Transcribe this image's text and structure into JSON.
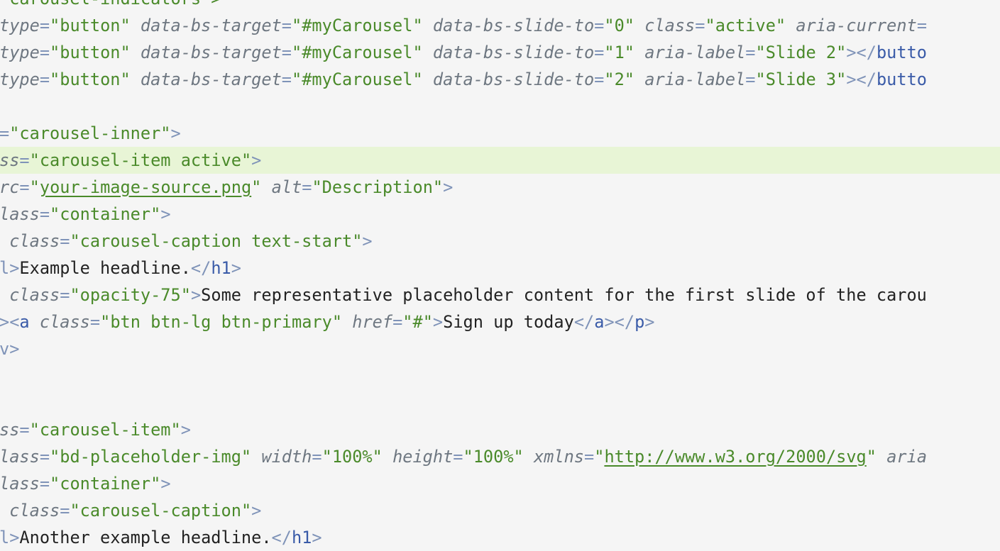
{
  "editor": {
    "current_line_index": 6,
    "colors": {
      "background": "#f5f5f5",
      "current_line": "#e8f5d6",
      "attribute": "#6e7781",
      "punctuation": "#7f93b8",
      "string": "#4a8a2a",
      "tag": "#3a5ba8",
      "text": "#222222"
    },
    "lines": [
      [
        {
          "t": "\"carousel-indicators\">",
          "k": "str"
        }
      ],
      [
        {
          "t": "type",
          "k": "attr"
        },
        {
          "t": "=",
          "k": "punct"
        },
        {
          "t": "\"button\"",
          "k": "str"
        },
        {
          "t": " ",
          "k": "text"
        },
        {
          "t": "data-bs-target",
          "k": "attr"
        },
        {
          "t": "=",
          "k": "punct"
        },
        {
          "t": "\"#myCarousel\"",
          "k": "str"
        },
        {
          "t": " ",
          "k": "text"
        },
        {
          "t": "data-bs-slide-to",
          "k": "attr"
        },
        {
          "t": "=",
          "k": "punct"
        },
        {
          "t": "\"0\"",
          "k": "str"
        },
        {
          "t": " ",
          "k": "text"
        },
        {
          "t": "class",
          "k": "attr"
        },
        {
          "t": "=",
          "k": "punct"
        },
        {
          "t": "\"active\"",
          "k": "str"
        },
        {
          "t": " ",
          "k": "text"
        },
        {
          "t": "aria-current",
          "k": "attr"
        },
        {
          "t": "=",
          "k": "punct"
        }
      ],
      [
        {
          "t": "type",
          "k": "attr"
        },
        {
          "t": "=",
          "k": "punct"
        },
        {
          "t": "\"button\"",
          "k": "str"
        },
        {
          "t": " ",
          "k": "text"
        },
        {
          "t": "data-bs-target",
          "k": "attr"
        },
        {
          "t": "=",
          "k": "punct"
        },
        {
          "t": "\"#myCarousel\"",
          "k": "str"
        },
        {
          "t": " ",
          "k": "text"
        },
        {
          "t": "data-bs-slide-to",
          "k": "attr"
        },
        {
          "t": "=",
          "k": "punct"
        },
        {
          "t": "\"1\"",
          "k": "str"
        },
        {
          "t": " ",
          "k": "text"
        },
        {
          "t": "aria-label",
          "k": "attr"
        },
        {
          "t": "=",
          "k": "punct"
        },
        {
          "t": "\"Slide 2\"",
          "k": "str"
        },
        {
          "t": "></",
          "k": "punct"
        },
        {
          "t": "butto",
          "k": "tag"
        }
      ],
      [
        {
          "t": "type",
          "k": "attr"
        },
        {
          "t": "=",
          "k": "punct"
        },
        {
          "t": "\"button\"",
          "k": "str"
        },
        {
          "t": " ",
          "k": "text"
        },
        {
          "t": "data-bs-target",
          "k": "attr"
        },
        {
          "t": "=",
          "k": "punct"
        },
        {
          "t": "\"#myCarousel\"",
          "k": "str"
        },
        {
          "t": " ",
          "k": "text"
        },
        {
          "t": "data-bs-slide-to",
          "k": "attr"
        },
        {
          "t": "=",
          "k": "punct"
        },
        {
          "t": "\"2\"",
          "k": "str"
        },
        {
          "t": " ",
          "k": "text"
        },
        {
          "t": "aria-label",
          "k": "attr"
        },
        {
          "t": "=",
          "k": "punct"
        },
        {
          "t": "\"Slide 3\"",
          "k": "str"
        },
        {
          "t": "></",
          "k": "punct"
        },
        {
          "t": "butto",
          "k": "tag"
        }
      ],
      [],
      [
        {
          "t": "=",
          "k": "punct"
        },
        {
          "t": "\"carousel-inner\"",
          "k": "str"
        },
        {
          "t": ">",
          "k": "punct"
        }
      ],
      [
        {
          "t": "ss",
          "k": "attr"
        },
        {
          "t": "=",
          "k": "punct"
        },
        {
          "t": "\"carousel-item active\"",
          "k": "str"
        },
        {
          "t": ">",
          "k": "punct"
        }
      ],
      [
        {
          "t": "rc",
          "k": "attr"
        },
        {
          "t": "=",
          "k": "punct"
        },
        {
          "t": "\"",
          "k": "str"
        },
        {
          "t": "your-image-source.png",
          "k": "link"
        },
        {
          "t": "\"",
          "k": "str"
        },
        {
          "t": " ",
          "k": "text"
        },
        {
          "t": "alt",
          "k": "attr"
        },
        {
          "t": "=",
          "k": "punct"
        },
        {
          "t": "\"Description\"",
          "k": "str"
        },
        {
          "t": ">",
          "k": "punct"
        }
      ],
      [
        {
          "t": "lass",
          "k": "attr"
        },
        {
          "t": "=",
          "k": "punct"
        },
        {
          "t": "\"container\"",
          "k": "str"
        },
        {
          "t": ">",
          "k": "punct"
        }
      ],
      [
        {
          "t": " ",
          "k": "text"
        },
        {
          "t": "class",
          "k": "attr"
        },
        {
          "t": "=",
          "k": "punct"
        },
        {
          "t": "\"carousel-caption text-start\"",
          "k": "str"
        },
        {
          "t": ">",
          "k": "punct"
        }
      ],
      [
        {
          "t": "l>",
          "k": "punct"
        },
        {
          "t": "Example headline.",
          "k": "text"
        },
        {
          "t": "</",
          "k": "punct"
        },
        {
          "t": "h1",
          "k": "tag"
        },
        {
          "t": ">",
          "k": "punct"
        }
      ],
      [
        {
          "t": " ",
          "k": "text"
        },
        {
          "t": "class",
          "k": "attr"
        },
        {
          "t": "=",
          "k": "punct"
        },
        {
          "t": "\"opacity-75\"",
          "k": "str"
        },
        {
          "t": ">",
          "k": "punct"
        },
        {
          "t": "Some representative placeholder content for the first slide of the carou",
          "k": "text"
        }
      ],
      [
        {
          "t": "><",
          "k": "punct"
        },
        {
          "t": "a",
          "k": "tag"
        },
        {
          "t": " ",
          "k": "text"
        },
        {
          "t": "class",
          "k": "attr"
        },
        {
          "t": "=",
          "k": "punct"
        },
        {
          "t": "\"btn btn-lg btn-primary\"",
          "k": "str"
        },
        {
          "t": " ",
          "k": "text"
        },
        {
          "t": "href",
          "k": "attr"
        },
        {
          "t": "=",
          "k": "punct"
        },
        {
          "t": "\"#\"",
          "k": "str"
        },
        {
          "t": ">",
          "k": "punct"
        },
        {
          "t": "Sign up today",
          "k": "text"
        },
        {
          "t": "</",
          "k": "punct"
        },
        {
          "t": "a",
          "k": "tag"
        },
        {
          "t": "></",
          "k": "punct"
        },
        {
          "t": "p",
          "k": "tag"
        },
        {
          "t": ">",
          "k": "punct"
        }
      ],
      [
        {
          "t": "v>",
          "k": "punct"
        }
      ],
      [],
      [],
      [
        {
          "t": "ss",
          "k": "attr"
        },
        {
          "t": "=",
          "k": "punct"
        },
        {
          "t": "\"carousel-item\"",
          "k": "str"
        },
        {
          "t": ">",
          "k": "punct"
        }
      ],
      [
        {
          "t": "lass",
          "k": "attr"
        },
        {
          "t": "=",
          "k": "punct"
        },
        {
          "t": "\"bd-placeholder-img\"",
          "k": "str"
        },
        {
          "t": " ",
          "k": "text"
        },
        {
          "t": "width",
          "k": "attr"
        },
        {
          "t": "=",
          "k": "punct"
        },
        {
          "t": "\"100%\"",
          "k": "str"
        },
        {
          "t": " ",
          "k": "text"
        },
        {
          "t": "height",
          "k": "attr"
        },
        {
          "t": "=",
          "k": "punct"
        },
        {
          "t": "\"100%\"",
          "k": "str"
        },
        {
          "t": " ",
          "k": "text"
        },
        {
          "t": "xmlns",
          "k": "attr"
        },
        {
          "t": "=",
          "k": "punct"
        },
        {
          "t": "\"",
          "k": "str"
        },
        {
          "t": "http://www.w3.org/2000/svg",
          "k": "link"
        },
        {
          "t": "\"",
          "k": "str"
        },
        {
          "t": " ",
          "k": "text"
        },
        {
          "t": "aria",
          "k": "attr"
        }
      ],
      [
        {
          "t": "lass",
          "k": "attr"
        },
        {
          "t": "=",
          "k": "punct"
        },
        {
          "t": "\"container\"",
          "k": "str"
        },
        {
          "t": ">",
          "k": "punct"
        }
      ],
      [
        {
          "t": " ",
          "k": "text"
        },
        {
          "t": "class",
          "k": "attr"
        },
        {
          "t": "=",
          "k": "punct"
        },
        {
          "t": "\"carousel-caption\"",
          "k": "str"
        },
        {
          "t": ">",
          "k": "punct"
        }
      ],
      [
        {
          "t": "l>",
          "k": "punct"
        },
        {
          "t": "Another example headline.",
          "k": "text"
        },
        {
          "t": "</",
          "k": "punct"
        },
        {
          "t": "h1",
          "k": "tag"
        },
        {
          "t": ">",
          "k": "punct"
        }
      ]
    ]
  }
}
